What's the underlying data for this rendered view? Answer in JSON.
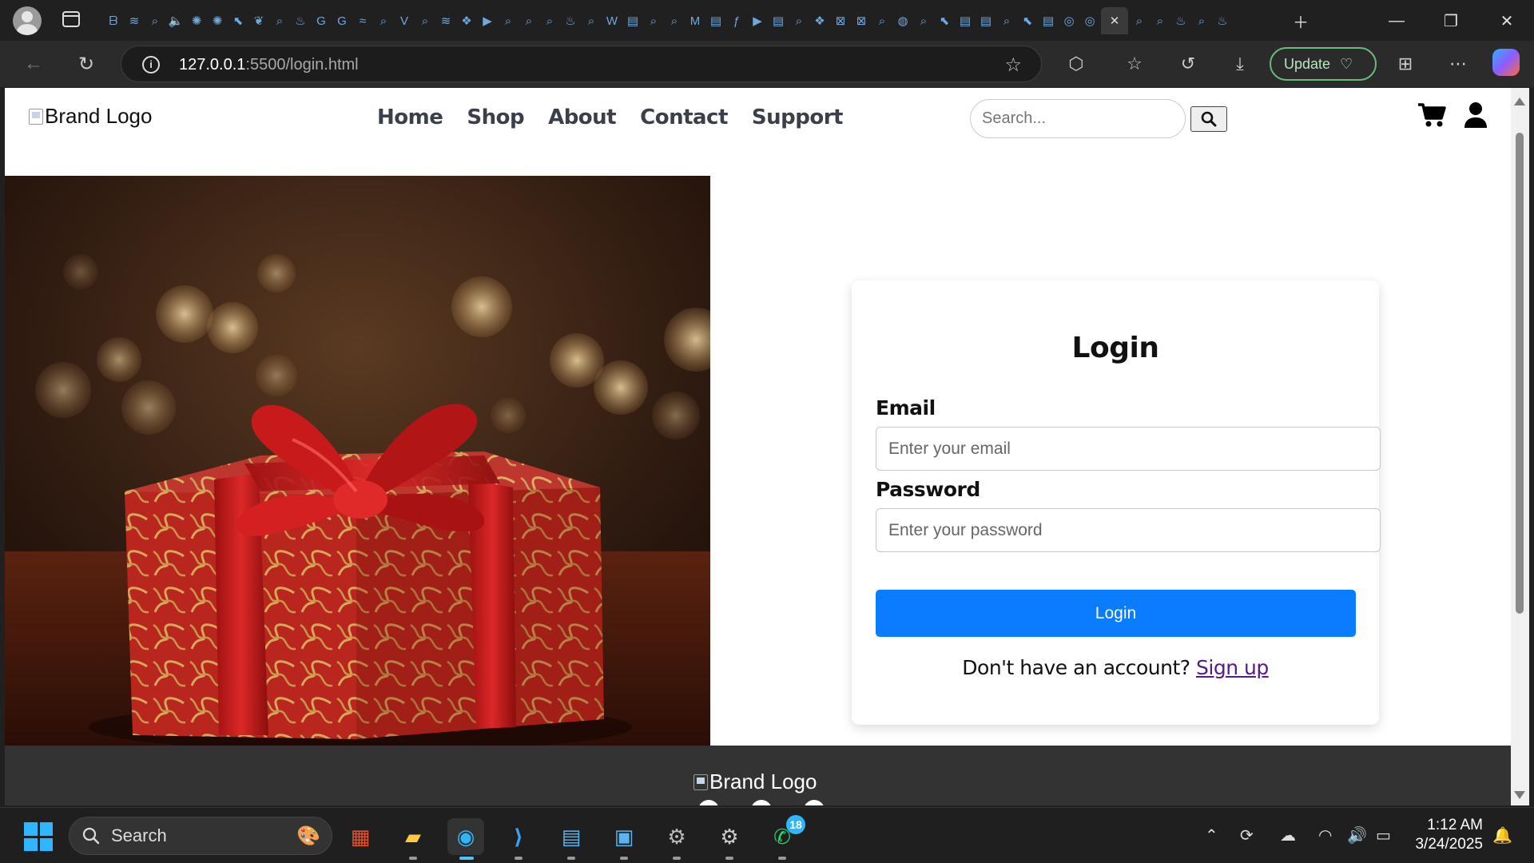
{
  "browser": {
    "tab_count_icons": [
      "edge",
      "gallery",
      "search",
      "audio",
      "openai",
      "openai",
      "cursor",
      "leaf",
      "search",
      "fire",
      "google",
      "google",
      "fish",
      "search",
      "vuetify",
      "search",
      "gallery",
      "figma",
      "youtube",
      "search",
      "search",
      "search",
      "fire",
      "search",
      "wikipedia",
      "notes",
      "search",
      "search",
      "medium",
      "notes",
      "formula",
      "youtube",
      "notes",
      "search",
      "figma",
      "file-x",
      "file-x",
      "search",
      "html",
      "search",
      "cursor",
      "notes",
      "notes",
      "search",
      "cursor",
      "notes",
      "globe",
      "globe"
    ],
    "url_host": "127.0.0.1",
    "url_rest": ":5500/login.html",
    "update_label": "Update"
  },
  "site": {
    "brand_alt": "Brand Logo",
    "nav": [
      "Home",
      "Shop",
      "About",
      "Contact",
      "Support"
    ],
    "search_placeholder": "Search...",
    "hero_alt": "Red and gold wrapped gift box with a red bow on a bokeh background"
  },
  "login": {
    "title": "Login",
    "email_label": "Email",
    "email_placeholder": "Enter your email",
    "password_label": "Password",
    "password_placeholder": "Enter your password",
    "button": "Login",
    "signup_prompt": "Don't have an account?",
    "signup_link": "Sign up"
  },
  "footer": {
    "brand_alt": "Brand Logo"
  },
  "taskbar": {
    "search_label": "Search",
    "whatsapp_badge": "18",
    "time": "1:12 AM",
    "date": "3/24/2025"
  },
  "colors": {
    "primary_button": "#0a7cff",
    "link_visited": "#551a8b",
    "footer_bg": "#333333",
    "update_border": "#6aba7a"
  }
}
